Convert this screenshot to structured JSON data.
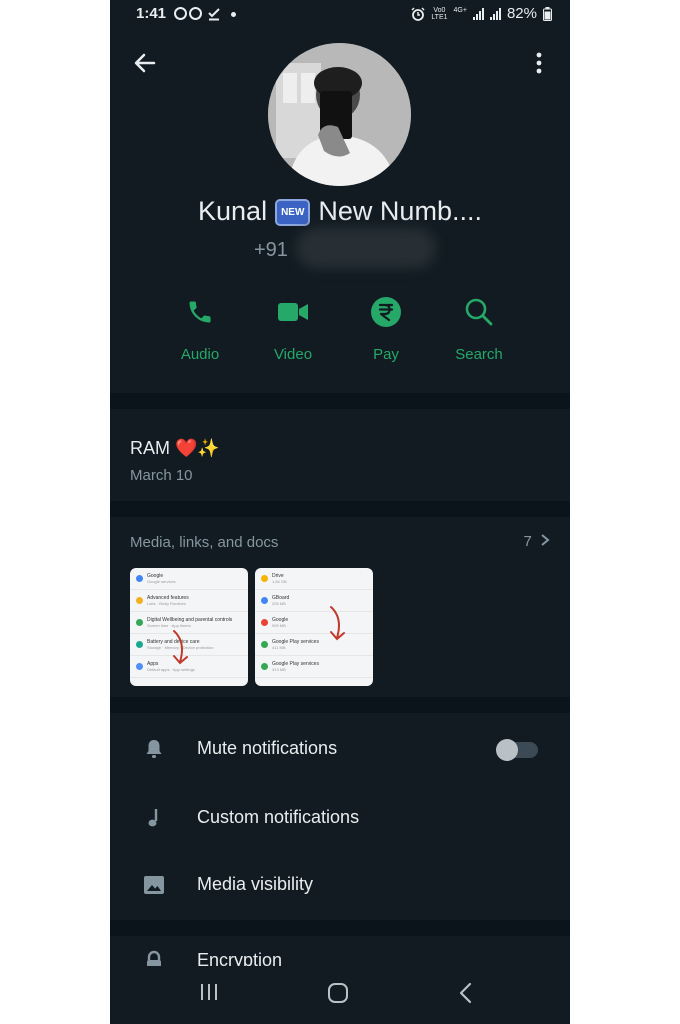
{
  "status": {
    "time": "1:41",
    "network_top": "Vo0",
    "network_bottom": "LTE1",
    "net_type": "4G+",
    "battery": "82%"
  },
  "contact": {
    "name_first": "Kunal",
    "badge": "NEW",
    "name_rest": "New Numb....",
    "phone_prefix": "+91"
  },
  "actions": [
    {
      "label": "Audio",
      "icon": "phone-icon"
    },
    {
      "label": "Video",
      "icon": "video-icon"
    },
    {
      "label": "Pay",
      "icon": "rupee-icon"
    },
    {
      "label": "Search",
      "icon": "search-icon"
    }
  ],
  "about": {
    "text": "RAM ❤️✨",
    "date": "March 10"
  },
  "media": {
    "title": "Media, links, and docs",
    "count": "7",
    "thumb1": [
      {
        "title": "Google",
        "sub": "Google services",
        "color": "#4285f4"
      },
      {
        "title": "Advanced features",
        "sub": "Labs · Bixby Routines",
        "color": "#f2b01e"
      },
      {
        "title": "Digital Wellbeing and parental controls",
        "sub": "Screen time · App timers",
        "color": "#35a853"
      },
      {
        "title": "Battery and device care",
        "sub": "Storage · Memory · Device protection",
        "color": "#1aa891"
      },
      {
        "title": "Apps",
        "sub": "Default apps · App settings",
        "color": "#4f8ef7"
      }
    ],
    "thumb2": [
      {
        "title": "Drive",
        "sub": "1.84 GB",
        "color": "#f4b400"
      },
      {
        "title": "GBoard",
        "sub": "205 MB",
        "color": "#4285f4"
      },
      {
        "title": "Google",
        "sub": "905 MB",
        "color": "#ea4335"
      },
      {
        "title": "Google Play services",
        "sub": "411 MB",
        "color": "#34a853"
      },
      {
        "title": "Google Play services",
        "sub": "313 MB",
        "color": "#34a853"
      }
    ]
  },
  "settings": {
    "mute": "Mute notifications",
    "custom": "Custom notifications",
    "media_visibility": "Media visibility",
    "encryption": "Encryption"
  },
  "colors": {
    "accent": "#25a868",
    "background": "#111b21",
    "divider": "#0b141a"
  }
}
